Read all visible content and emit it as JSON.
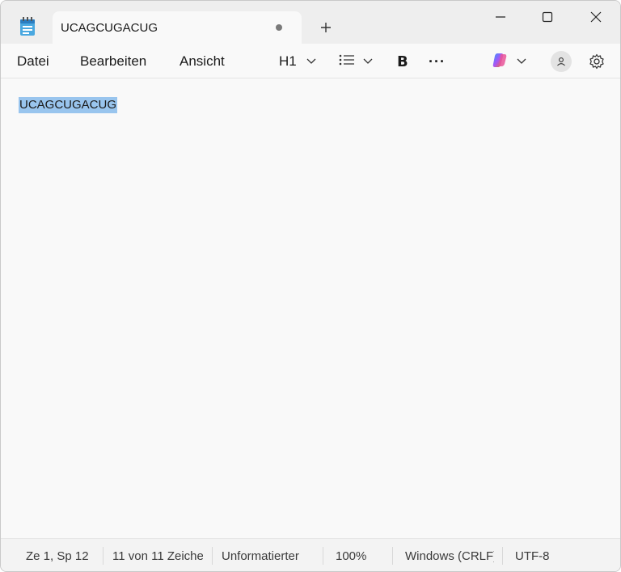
{
  "window": {
    "tab_title": "UCAGCUGACUG",
    "icons": {
      "app": "notepad-icon",
      "new_tab": "plus-icon",
      "minimize": "minimize-icon",
      "maximize": "maximize-icon",
      "close": "close-icon"
    }
  },
  "menu": {
    "file": "Datei",
    "edit": "Bearbeiten",
    "view": "Ansicht"
  },
  "toolbar": {
    "heading": "H1",
    "bold": "B",
    "more": "···",
    "icons": {
      "heading_dropdown": "chevron-down-icon",
      "list": "list-icon",
      "copilot": "copilot-icon",
      "account": "account-icon",
      "settings": "gear-icon"
    }
  },
  "editor": {
    "content": "UCAGCUGACUG",
    "selection_color": "#99c5ee"
  },
  "status": {
    "position": "Ze 1, Sp 12",
    "characters": "11 von 11 Zeichen",
    "format": "Unformatierter",
    "zoom": "100%",
    "line_ending": "Windows (CRLF)",
    "encoding": "UTF-8"
  }
}
